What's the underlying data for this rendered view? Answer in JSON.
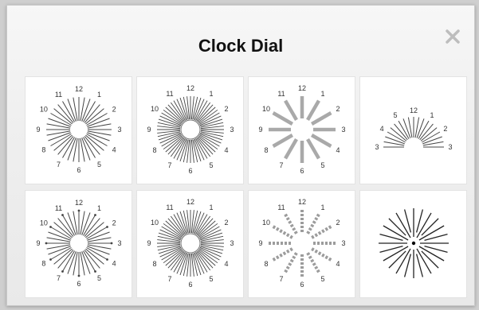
{
  "dialog": {
    "title": "Clock Dial",
    "close_icon": "close-x-icon"
  },
  "clock_numbers_full": [
    "12",
    "1",
    "2",
    "3",
    "4",
    "5",
    "6",
    "7",
    "8",
    "9",
    "10",
    "11"
  ],
  "clock_numbers_half": [
    "3",
    "4",
    "5",
    "12",
    "1",
    "2",
    "3"
  ],
  "tiles": [
    {
      "name": "dial-thin-lines-small-hub",
      "style": "thin"
    },
    {
      "name": "dial-dense-thin-lines",
      "style": "dense"
    },
    {
      "name": "dial-thick-gray-bars",
      "style": "thick"
    },
    {
      "name": "dial-half-fan",
      "style": "half"
    },
    {
      "name": "dial-arrow-lines",
      "style": "arrow"
    },
    {
      "name": "dial-dense-arrow-lines",
      "style": "dense-arrow"
    },
    {
      "name": "dial-dashed-gray-bars",
      "style": "dashed"
    },
    {
      "name": "dial-starburst-no-numbers",
      "style": "starburst"
    }
  ],
  "colors": {
    "line": "#444444",
    "thick": "#a9a9a9",
    "dashed": "#9c9c9c"
  }
}
